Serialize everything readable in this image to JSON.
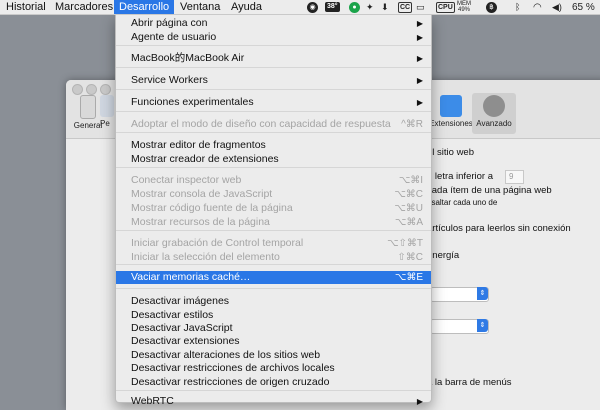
{
  "menubar": {
    "items": [
      {
        "label": "Historial"
      },
      {
        "label": "Marcadores"
      },
      {
        "label": "Desarrollo"
      },
      {
        "label": "Ventana"
      },
      {
        "label": "Ayuda"
      }
    ],
    "status": {
      "temperature": "38°",
      "cpu_badge": "CPU",
      "mem_label": "MEM",
      "mem_value": "49%",
      "battery_percent": "65 %"
    }
  },
  "prefs": {
    "toolbar": [
      {
        "label": "General"
      },
      {
        "label": "Pe"
      },
      {
        "label": "Extensiones"
      },
      {
        "label": "Avanzado"
      }
    ],
    "lines": [
      "el sitio web",
      "e letra inferior a",
      "cada ítem de una página web",
      "esaltar cada uno de",
      "artículos para leerlos sin conexión",
      "energía",
      "a la barra de menús"
    ],
    "font_min_value": "9"
  },
  "menu": {
    "items": [
      {
        "label": "Abrir página con",
        "shortcut": "",
        "disabled": false,
        "submenu": true
      },
      {
        "label": "Agente de usuario",
        "shortcut": "",
        "disabled": false,
        "submenu": true
      },
      {
        "label": "MacBook的MacBook Air",
        "shortcut": "",
        "disabled": false,
        "submenu": true
      },
      {
        "label": "Service Workers",
        "shortcut": "",
        "disabled": false,
        "submenu": true
      },
      {
        "label": "Funciones experimentales",
        "shortcut": "",
        "disabled": false,
        "submenu": true
      },
      {
        "label": "Adoptar el modo de diseño con capacidad de respuesta",
        "shortcut": "^⌘R",
        "disabled": true,
        "submenu": false
      },
      {
        "label": "Mostrar editor de fragmentos",
        "shortcut": "",
        "disabled": false,
        "submenu": false
      },
      {
        "label": "Mostrar creador de extensiones",
        "shortcut": "",
        "disabled": false,
        "submenu": false
      },
      {
        "label": "Conectar inspector web",
        "shortcut": "⌥⌘I",
        "disabled": true,
        "submenu": false
      },
      {
        "label": "Mostrar consola de JavaScript",
        "shortcut": "⌥⌘C",
        "disabled": true,
        "submenu": false
      },
      {
        "label": "Mostrar código fuente de la página",
        "shortcut": "⌥⌘U",
        "disabled": true,
        "submenu": false
      },
      {
        "label": "Mostrar recursos de la página",
        "shortcut": "⌥⌘A",
        "disabled": true,
        "submenu": false
      },
      {
        "label": "Iniciar grabación de Control temporal",
        "shortcut": "⌥⇧⌘T",
        "disabled": true,
        "submenu": false
      },
      {
        "label": "Iniciar la selección del elemento",
        "shortcut": "⇧⌘C",
        "disabled": true,
        "submenu": false
      },
      {
        "label": "Vaciar memorias caché…",
        "shortcut": "⌥⌘E",
        "disabled": false,
        "submenu": false,
        "selected": true
      },
      {
        "label": "Desactivar imágenes",
        "shortcut": "",
        "disabled": false,
        "submenu": false
      },
      {
        "label": "Desactivar estilos",
        "shortcut": "",
        "disabled": false,
        "submenu": false
      },
      {
        "label": "Desactivar JavaScript",
        "shortcut": "",
        "disabled": false,
        "submenu": false
      },
      {
        "label": "Desactivar extensiones",
        "shortcut": "",
        "disabled": false,
        "submenu": false
      },
      {
        "label": "Desactivar alteraciones de los sitios web",
        "shortcut": "",
        "disabled": false,
        "submenu": false
      },
      {
        "label": "Desactivar restricciones de archivos locales",
        "shortcut": "",
        "disabled": false,
        "submenu": false
      },
      {
        "label": "Desactivar restricciones de origen cruzado",
        "shortcut": "",
        "disabled": false,
        "submenu": false
      },
      {
        "label": "WebRTC",
        "shortcut": "",
        "disabled": false,
        "submenu": true
      }
    ]
  },
  "colors": {
    "accent": "#2a77e6",
    "disabled_text": "#a4a4a4"
  }
}
